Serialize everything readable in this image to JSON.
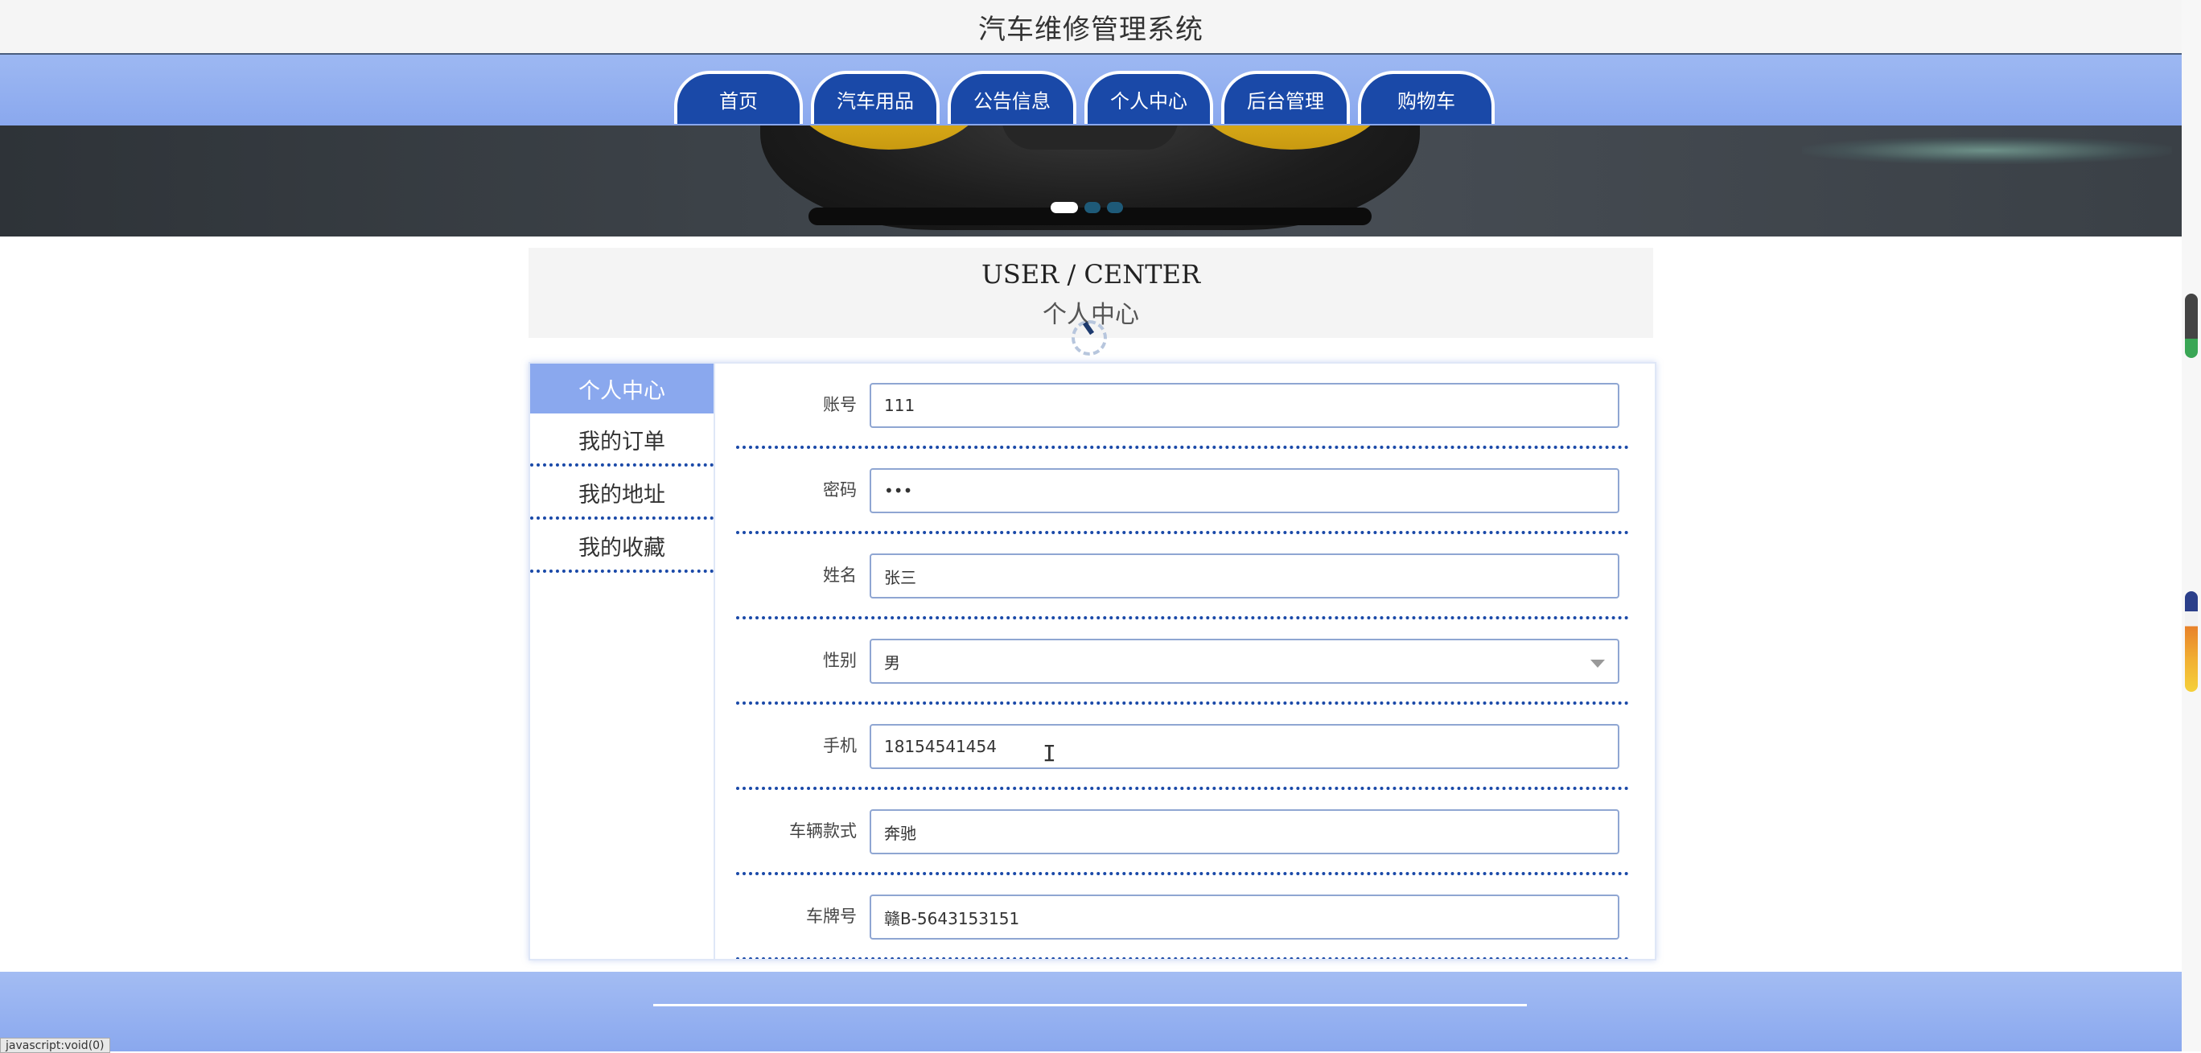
{
  "site": {
    "title": "汽车维修管理系统"
  },
  "nav": {
    "items": [
      {
        "label": "首页"
      },
      {
        "label": "汽车用品"
      },
      {
        "label": "公告信息"
      },
      {
        "label": "个人中心"
      },
      {
        "label": "后台管理"
      },
      {
        "label": "购物车"
      }
    ]
  },
  "banner": {
    "slide_count": 3,
    "active_slide": 1
  },
  "header": {
    "title_en": "USER / CENTER",
    "title_cn": "个人中心"
  },
  "sidebar": {
    "items": [
      {
        "label": "个人中心",
        "active": true
      },
      {
        "label": "我的订单",
        "active": false
      },
      {
        "label": "我的地址",
        "active": false
      },
      {
        "label": "我的收藏",
        "active": false
      }
    ]
  },
  "form": {
    "fields": [
      {
        "label": "账号",
        "value": "111"
      },
      {
        "label": "密码",
        "value": "•••"
      },
      {
        "label": "姓名",
        "value": "张三"
      },
      {
        "label": "性别",
        "value": "男"
      },
      {
        "label": "手机",
        "value": "18154541454"
      },
      {
        "label": "车辆款式",
        "value": "奔驰"
      },
      {
        "label": "车牌号",
        "value": "赣B-5643153151"
      }
    ]
  },
  "status_bar": {
    "text": "javascript:void(0)"
  }
}
